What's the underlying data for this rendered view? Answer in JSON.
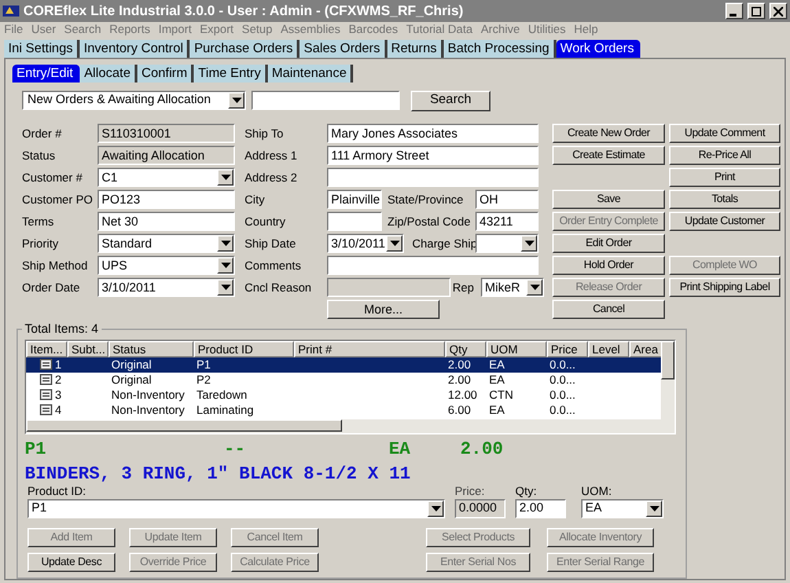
{
  "window": {
    "title": "COREflex Lite Industrial 3.0.0 - User : Admin - (CFXWMS_RF_Chris)"
  },
  "menu": [
    "File",
    "User",
    "Search",
    "Reports",
    "Import",
    "Export",
    "Setup",
    "Assemblies",
    "Barcodes",
    "Tutorial Data",
    "Archive",
    "Utilities",
    "Help"
  ],
  "tabs": [
    {
      "label": "Ini Settings",
      "selected": false
    },
    {
      "label": "Inventory Control",
      "selected": false
    },
    {
      "label": "Purchase Orders",
      "selected": false
    },
    {
      "label": "Sales Orders",
      "selected": false
    },
    {
      "label": "Returns",
      "selected": false
    },
    {
      "label": "Batch Processing",
      "selected": false
    },
    {
      "label": "Work Orders",
      "selected": true
    }
  ],
  "subtabs": [
    {
      "label": "Entry/Edit",
      "selected": true
    },
    {
      "label": "Allocate",
      "selected": false
    },
    {
      "label": "Confirm",
      "selected": false
    },
    {
      "label": "Time Entry",
      "selected": false
    },
    {
      "label": "Maintenance",
      "selected": false
    }
  ],
  "filter": {
    "value": "New Orders & Awaiting Allocation",
    "search_button": "Search"
  },
  "form": [
    {
      "left": {
        "label": "Order #",
        "value": "S110310001",
        "kind": "readonly"
      },
      "middle": {
        "label": "Ship To",
        "value": "Mary Jones Associates",
        "kind": "text"
      }
    },
    {
      "left": {
        "label": "Status",
        "value": "Awaiting Allocation",
        "kind": "readonly"
      },
      "middle": {
        "label": "Address 1",
        "value": "111 Armory Street",
        "kind": "text"
      }
    },
    {
      "left": {
        "label": "Customer #",
        "value": "C1",
        "kind": "dropdown"
      },
      "middle": {
        "label": "Address 2",
        "kind": "text"
      }
    },
    {
      "left": {
        "label": "Customer PO",
        "value": "PO123",
        "kind": "text"
      },
      "middle": {
        "label": "City",
        "value": "Plainville",
        "kind": "short"
      },
      "extra": {
        "label": "State/Province",
        "value": "OH",
        "kind": "text"
      }
    },
    {
      "left": {
        "label": "Terms",
        "value": "Net 30",
        "kind": "text"
      },
      "middle": {
        "label": "Country",
        "kind": "short"
      },
      "extra": {
        "label": "Zip/Postal Code",
        "value": "43211",
        "kind": "text"
      }
    },
    {
      "left": {
        "label": "Priority",
        "value": "Standard",
        "kind": "dropdown"
      },
      "middle": {
        "label": "Ship Date",
        "value": "3/10/2011",
        "kind": "shortdropdown"
      },
      "extra": {
        "label": "Charge Ship",
        "kind": "dropdown"
      }
    },
    {
      "left": {
        "label": "Ship Method",
        "value": "UPS",
        "kind": "dropdown"
      },
      "middle": {
        "label": "Comments",
        "kind": "text"
      }
    },
    {
      "left": {
        "label": "Order Date",
        "value": "3/10/2011",
        "kind": "dropdown"
      },
      "middle": {
        "label": "Cncl Reason",
        "kind": "readonly_short"
      },
      "extra": {
        "label": "Rep",
        "value": "MikeR",
        "kind": "dropdown"
      }
    }
  ],
  "more_button": "More...",
  "actions": [
    [
      {
        "kind": "button",
        "label": "Create New Order",
        "disabled": false
      },
      {
        "kind": "button",
        "label": "Create Estimate",
        "disabled": false
      },
      {
        "kind": "spacer"
      },
      {
        "kind": "button",
        "label": "Save",
        "disabled": false
      },
      {
        "kind": "button",
        "label": "Order Entry Complete",
        "disabled": true
      },
      {
        "kind": "button",
        "label": "Edit Order",
        "disabled": false
      },
      {
        "kind": "button",
        "label": "Hold Order",
        "disabled": false
      },
      {
        "kind": "button",
        "label": "Release Order",
        "disabled": true
      },
      {
        "kind": "button",
        "label": "Cancel",
        "disabled": false
      }
    ],
    [
      {
        "kind": "button",
        "label": "Update Comment",
        "disabled": false
      },
      {
        "kind": "button",
        "label": "Re-Price All",
        "disabled": false
      },
      {
        "kind": "button",
        "label": "Print",
        "disabled": false
      },
      {
        "kind": "button",
        "label": "Totals",
        "disabled": false
      },
      {
        "kind": "button",
        "label": "Update Customer",
        "disabled": false
      },
      {
        "kind": "spacer"
      },
      {
        "kind": "button",
        "label": "Complete WO",
        "disabled": true
      },
      {
        "kind": "button",
        "label": "Print Shipping Label",
        "disabled": false
      }
    ]
  ],
  "items": {
    "legend": "Total Items: 4",
    "columns": [
      "Item...",
      "Subt...",
      "Status",
      "Product ID",
      "Print #",
      "Qty",
      "UOM",
      "Price",
      "Level",
      "Area"
    ],
    "rows": [
      {
        "selected": true,
        "cells": [
          "1",
          "",
          "Original",
          "P1",
          "",
          "2.00",
          "EA",
          "0.0...",
          "",
          ""
        ]
      },
      {
        "selected": false,
        "cells": [
          "2",
          "",
          "Original",
          "P2",
          "",
          "2.00",
          "EA",
          "0.0...",
          "",
          ""
        ]
      },
      {
        "selected": false,
        "cells": [
          "3",
          "",
          "Non-Inventory",
          "Taredown",
          "",
          "12.00",
          "CTN",
          "0.0...",
          "",
          ""
        ]
      },
      {
        "selected": false,
        "cells": [
          "4",
          "",
          "Non-Inventory",
          "Laminating",
          "",
          "6.00",
          "EA",
          "0.0...",
          "",
          ""
        ]
      }
    ]
  },
  "detail": {
    "product": "P1",
    "dash": "--",
    "uom": "EA",
    "qty": "2.00",
    "description": "BINDERS, 3 RING, 1\" BLACK 8-1/2 X 11"
  },
  "entry": {
    "product_label": "Product ID:",
    "product": "P1",
    "price_label": "Price:",
    "price": "0.0000",
    "qty_label": "Qty:",
    "qty": "2.00",
    "uom_label": "UOM:",
    "uom": "EA"
  },
  "item_buttons": [
    [
      {
        "label": "Add Item",
        "disabled": true
      },
      {
        "label": "Update Item",
        "disabled": true
      },
      {
        "label": "Cancel Item",
        "disabled": true
      },
      {
        "label": "Select Products",
        "disabled": true
      },
      {
        "label": "Allocate Inventory",
        "disabled": true
      }
    ],
    [
      {
        "label": "Update Desc",
        "disabled": false
      },
      {
        "label": "Override Price",
        "disabled": true
      },
      {
        "label": "Calculate Price",
        "disabled": true
      },
      {
        "label": "Enter Serial Nos",
        "disabled": true
      },
      {
        "label": "Enter Serial Range",
        "disabled": true
      }
    ]
  ]
}
